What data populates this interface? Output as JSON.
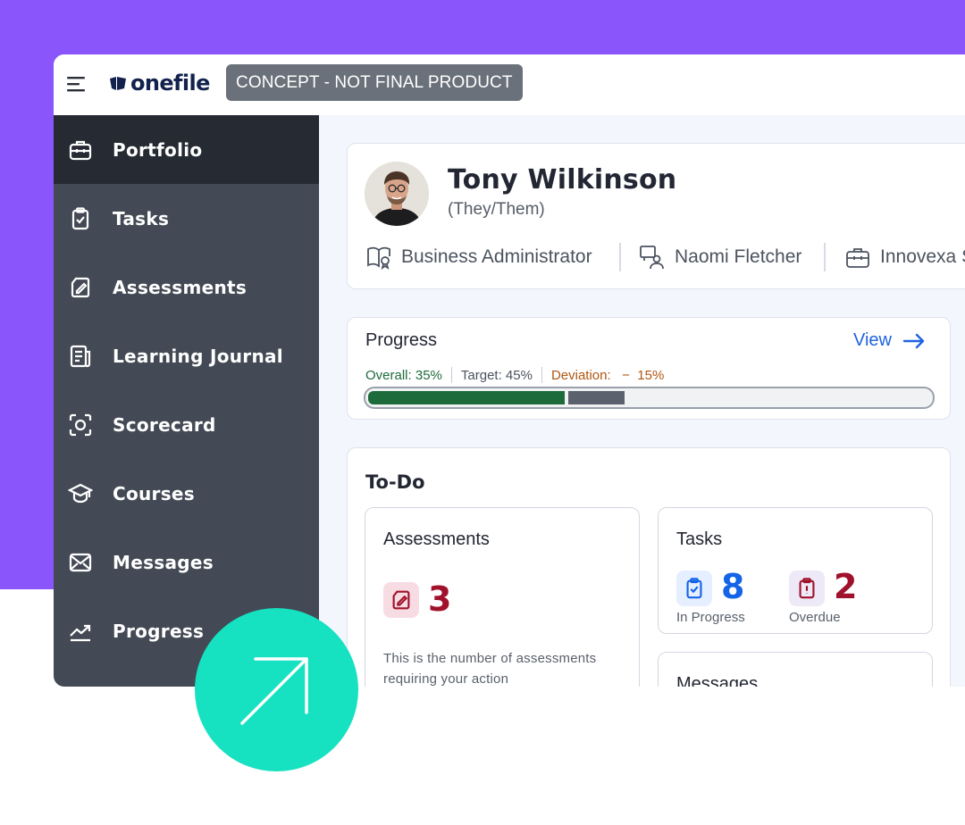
{
  "brand": {
    "logo_text": "onefile",
    "badge": "CONCEPT - NOT FINAL PRODUCT"
  },
  "sidebar": {
    "items": [
      {
        "label": "Portfolio",
        "icon": "briefcase-icon",
        "active": true
      },
      {
        "label": "Tasks",
        "icon": "clipboard-check-icon"
      },
      {
        "label": "Assessments",
        "icon": "assessment-edit-icon"
      },
      {
        "label": "Learning Journal",
        "icon": "journal-icon"
      },
      {
        "label": "Scorecard",
        "icon": "scorecard-icon"
      },
      {
        "label": "Courses",
        "icon": "graduation-cap-icon"
      },
      {
        "label": "Messages",
        "icon": "envelope-icon"
      },
      {
        "label": "Progress",
        "icon": "trend-up-icon"
      }
    ]
  },
  "profile": {
    "name": "Tony Wilkinson",
    "pronouns": "(They/Them)",
    "role": "Business Administrator",
    "assessor": "Naomi Fletcher",
    "employer": "Innovexa S"
  },
  "progress": {
    "title": "Progress",
    "view_label": "View",
    "overall_label": "Overall:",
    "overall_value": "35%",
    "target_label": "Target:",
    "target_value": "45%",
    "deviation_label": "Deviation:",
    "deviation_sign": "−",
    "deviation_value": "15%",
    "overall_fraction": 0.35,
    "target_fraction": 0.45
  },
  "todo": {
    "title": "To-Do",
    "assessments": {
      "title": "Assessments",
      "count": "3",
      "description": "This is the number of assessments requiring your action"
    },
    "tasks": {
      "title": "Tasks",
      "in_progress_count": "8",
      "in_progress_label": "In Progress",
      "overdue_count": "2",
      "overdue_label": "Overdue"
    },
    "messages": {
      "title": "Messages"
    }
  },
  "colors": {
    "brand_purple": "#8a55fb",
    "sidebar": "#434a55",
    "sidebar_active": "#252a33",
    "progress_overall": "#1d6b3b",
    "progress_target": "#5b626d",
    "accent_teal": "#16e1c1",
    "link_blue": "#1f63e0",
    "alert_red": "#a0112b"
  }
}
